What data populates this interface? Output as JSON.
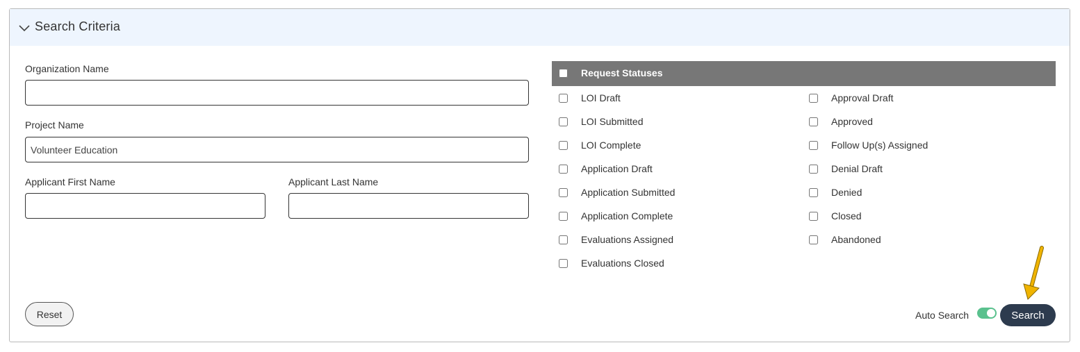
{
  "panel": {
    "title": "Search Criteria"
  },
  "fields": {
    "organization_name": {
      "label": "Organization Name",
      "value": ""
    },
    "project_name": {
      "label": "Project Name",
      "value": "Volunteer Education"
    },
    "applicant_first_name": {
      "label": "Applicant First Name",
      "value": ""
    },
    "applicant_last_name": {
      "label": "Applicant Last Name",
      "value": ""
    }
  },
  "statuses": {
    "header": "Request Statuses",
    "left": [
      {
        "label": "LOI Draft",
        "checked": false
      },
      {
        "label": "LOI Submitted",
        "checked": false
      },
      {
        "label": "LOI Complete",
        "checked": false
      },
      {
        "label": "Application Draft",
        "checked": false
      },
      {
        "label": "Application Submitted",
        "checked": false
      },
      {
        "label": "Application Complete",
        "checked": false
      },
      {
        "label": "Evaluations Assigned",
        "checked": false
      },
      {
        "label": "Evaluations Closed",
        "checked": false
      }
    ],
    "right": [
      {
        "label": "Approval Draft",
        "checked": false
      },
      {
        "label": "Approved",
        "checked": false
      },
      {
        "label": "Follow Up(s) Assigned",
        "checked": false
      },
      {
        "label": "Denial Draft",
        "checked": false
      },
      {
        "label": "Denied",
        "checked": false
      },
      {
        "label": "Closed",
        "checked": false
      },
      {
        "label": "Abandoned",
        "checked": false
      }
    ]
  },
  "actions": {
    "reset_label": "Reset",
    "auto_search_label": "Auto Search",
    "auto_search_on": true,
    "search_label": "Search"
  },
  "colors": {
    "header_bg": "#eef5fe",
    "status_header_bg": "#777777",
    "toggle_on": "#5ac18e",
    "search_btn": "#2d3b4e",
    "annotation_arrow": "#f0b400"
  },
  "icons": {
    "collapse": "chevron-down-icon",
    "annotation": "arrow-pointer-icon"
  }
}
